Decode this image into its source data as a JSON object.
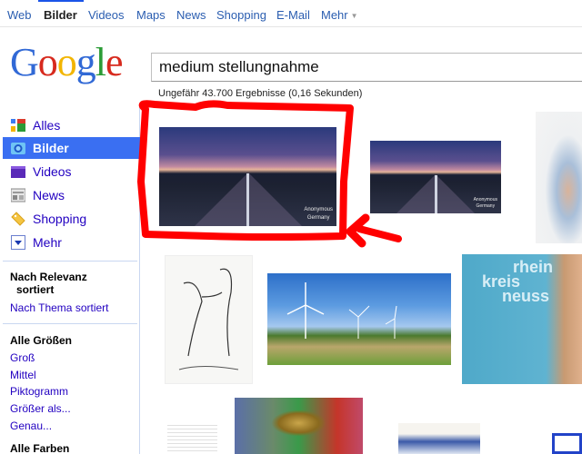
{
  "topnav": {
    "items": [
      {
        "label": "Web",
        "active": false
      },
      {
        "label": "Bilder",
        "active": true
      },
      {
        "label": "Videos",
        "active": false
      },
      {
        "label": "Maps",
        "active": false
      },
      {
        "label": "News",
        "active": false
      },
      {
        "label": "Shopping",
        "active": false
      },
      {
        "label": "E-Mail",
        "active": false
      },
      {
        "label": "Mehr",
        "active": false
      }
    ],
    "more_caret": "▼"
  },
  "logo": {
    "letters": [
      "G",
      "o",
      "o",
      "g",
      "l",
      "e"
    ]
  },
  "search": {
    "value": "medium stellungnahme",
    "stats": "Ungefähr 43.700 Ergebnisse (0,16 Sekunden)"
  },
  "sidebar": {
    "nav": [
      {
        "label": "Alles",
        "icon": "google-plus-icon"
      },
      {
        "label": "Bilder",
        "icon": "camera-icon",
        "selected": true
      },
      {
        "label": "Videos",
        "icon": "clapperboard-icon"
      },
      {
        "label": "News",
        "icon": "newspaper-icon"
      },
      {
        "label": "Shopping",
        "icon": "price-tag-icon"
      },
      {
        "label": "Mehr",
        "icon": "dropdown-icon"
      }
    ],
    "sort": {
      "selected_line1": "Nach Relevanz",
      "selected_line2": "sortiert",
      "option": "Nach Thema sortiert"
    },
    "sizes": {
      "title": "Alle Größen",
      "options": [
        "Groß",
        "Mittel",
        "Piktogramm",
        "Größer als...",
        "Genau..."
      ]
    },
    "colors": {
      "title": "Alle Farben"
    }
  },
  "results": [
    {
      "kind": "highway-dusk",
      "caption_line1": "Anonymous",
      "caption_line2": "Germany",
      "highlighted": true
    },
    {
      "kind": "highway-dusk",
      "caption_line1": "Anonymous",
      "caption_line2": "Germany"
    },
    {
      "kind": "map"
    },
    {
      "kind": "sketch"
    },
    {
      "kind": "wind-turbines"
    },
    {
      "kind": "portrait",
      "text_lines": [
        "rhein",
        "kreis",
        "neuss"
      ]
    },
    {
      "kind": "document"
    },
    {
      "kind": "world-cup-trophy"
    },
    {
      "kind": "church-drawing"
    },
    {
      "kind": "blue-logo"
    }
  ],
  "colors": {
    "link": "#2200c1",
    "nav_link": "#2a5db0",
    "selected_bg": "#3a6ff2",
    "annotation": "#ff0000"
  }
}
